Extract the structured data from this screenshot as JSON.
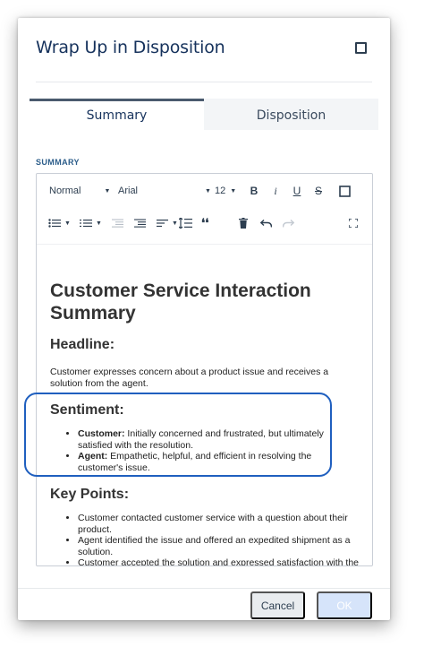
{
  "dialog": {
    "title": "Wrap Up in Disposition"
  },
  "tabs": [
    {
      "label": "Summary",
      "active": true
    },
    {
      "label": "Disposition",
      "active": false
    }
  ],
  "section": {
    "label": "SUMMARY"
  },
  "toolbar": {
    "paragraph_style": "Normal",
    "font_family": "Arial",
    "font_size": "12"
  },
  "document": {
    "title": "Customer Service Interaction Summary",
    "headline_heading": "Headline:",
    "headline_text": "Customer expresses concern about a product issue and receives a solution from the agent.",
    "sentiment_heading": "Sentiment:",
    "sentiment_items": [
      {
        "label": "Customer:",
        "text": " Initially concerned and frustrated, but ultimately satisfied with the resolution."
      },
      {
        "label": "Agent:",
        "text": " Empathetic, helpful, and efficient in resolving the customer's issue."
      }
    ],
    "keypoints_heading": "Key Points:",
    "keypoints_items": [
      "Customer contacted customer service with a question about their product.",
      "Agent identified the issue and offered an expedited shipment as a solution.",
      "Customer accepted the solution and expressed satisfaction with the outcome."
    ]
  },
  "footer": {
    "cancel_label": "Cancel",
    "ok_label": "OK"
  },
  "colors": {
    "accent": "#1f5fbf",
    "title": "#16325c",
    "ok_disabled": "#d6e4fa"
  }
}
